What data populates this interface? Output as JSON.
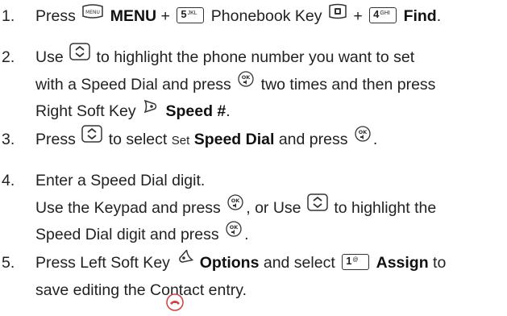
{
  "steps": [
    {
      "num": "1.",
      "press": "Press",
      "menu": "MENU",
      "plus1": "+",
      "key5": "5",
      "key5_sub": "JKL",
      "phonebook_key": "Phonebook Key",
      "plus2": "+",
      "key4": "4",
      "key4_sub": "GHI",
      "find": "Find",
      "period": "."
    },
    {
      "num": "2.",
      "use": "Use",
      "l1_rest": "to highlight the phone number you want to set",
      "l2_a": "with a Speed Dial and press",
      "l2_b": "two times and then press",
      "l3_a": "Right Soft Key",
      "speed": "Speed #",
      "period": "."
    },
    {
      "num": "3.",
      "press": "Press",
      "to_select": "to select",
      "set": "Set",
      "speed_dial": "Speed Dial",
      "and_press": "and press",
      "period": "."
    },
    {
      "num": "4.",
      "l1": "Enter a Speed Dial digit.",
      "l2_a": "Use the Keypad and press",
      "l2_b": ", or Use",
      "l2_c": "to highlight the",
      "l3_a": "Speed Dial digit and press",
      "period": "."
    },
    {
      "num": "5.",
      "l1_a": "Press Left Soft Key",
      "options": "Options",
      "and_select": "and select",
      "key1": "1",
      "key1_sub": "@",
      "assign": "Assign",
      "to": "to",
      "l2_a": "save editing the",
      "l2_b": "Contact entry",
      "period": "."
    }
  ],
  "icons": {
    "menu_key": "menu-key-icon",
    "phonebook": "phonebook-key-icon",
    "nav": "navigation-key-icon",
    "ok": "ok-key-icon",
    "right_soft": "right-soft-key-icon",
    "left_soft": "left-soft-key-icon",
    "end": "end-key-icon"
  },
  "colors": {
    "text": "#222222",
    "icon_border": "#333333",
    "end_key": "#d04040"
  }
}
